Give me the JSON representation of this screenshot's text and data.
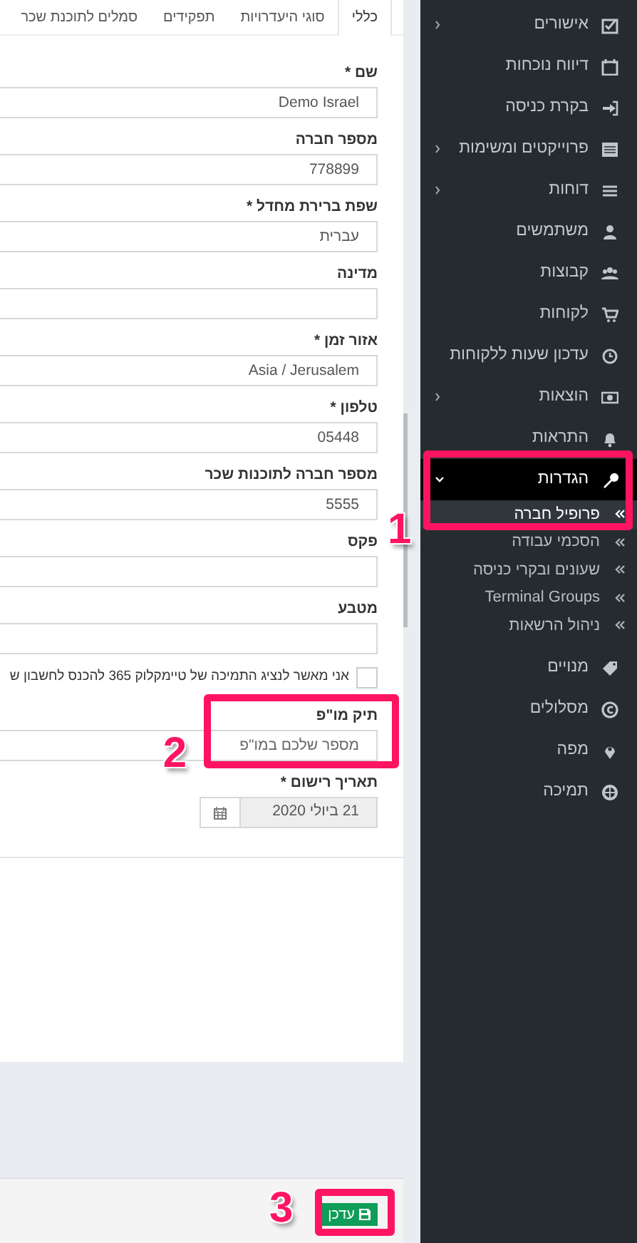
{
  "tabs": [
    {
      "label": "כללי",
      "selected": true
    },
    {
      "label": "סוגי היעדרויות",
      "selected": false
    },
    {
      "label": "תפקידים",
      "selected": false
    },
    {
      "label": "סמלים לתוכנת שכר",
      "selected": false
    }
  ],
  "form": {
    "fields": [
      {
        "kind": "text",
        "label": "שם *",
        "value": "Demo Israel"
      },
      {
        "kind": "text",
        "label": "מספר חברה",
        "value": "778899"
      },
      {
        "kind": "text",
        "label": "שפת ברירת מחדל *",
        "value": "עברית"
      },
      {
        "kind": "text",
        "label": "מדינה"
      },
      {
        "kind": "text",
        "label": "אזור זמן *",
        "value": "Asia / Jerusalem"
      },
      {
        "kind": "text",
        "label": "טלפון *",
        "value": "05448"
      },
      {
        "kind": "text",
        "label": "מספר חברה לתוכנות שכר",
        "value": "5555"
      },
      {
        "kind": "text",
        "label": "פקס"
      },
      {
        "kind": "text",
        "label": "מטבע"
      },
      {
        "kind": "checkbox",
        "label": "אני מאשר לנציג התמיכה של טיימקלוק 365 להכנס לחשבון ש",
        "checked": false
      },
      {
        "kind": "text",
        "label": "תיק מו\"פ",
        "placeholder": "מספר שלכם במו\"פ"
      },
      {
        "kind": "date",
        "label": "תאריך רישום *",
        "value": "21 ביולי 2020",
        "disabled": true
      }
    ],
    "submit": "עדכן"
  },
  "sidebar": {
    "items": [
      {
        "kind": "group",
        "label": "אישורים",
        "expanded": false
      },
      {
        "kind": "link",
        "label": "דיווח נוכחות"
      },
      {
        "kind": "link",
        "label": "בקרת כניסה"
      },
      {
        "kind": "group",
        "label": "פרוייקטים ומשימות",
        "expanded": false
      },
      {
        "kind": "group",
        "label": "דוחות",
        "expanded": false
      },
      {
        "kind": "link",
        "label": "משתמשים"
      },
      {
        "kind": "link",
        "label": "קבוצות"
      },
      {
        "kind": "link",
        "label": "לקוחות"
      },
      {
        "kind": "link",
        "label": "עדכון שעות ללקוחות"
      },
      {
        "kind": "group",
        "label": "הוצאות",
        "expanded": false
      },
      {
        "kind": "link",
        "label": "התראות"
      },
      {
        "kind": "group",
        "label": "הגדרות",
        "expanded": true,
        "children": [
          {
            "label": "פרופיל חברה",
            "selected": true
          },
          {
            "label": "הסכמי עבודה",
            "selected": false
          },
          {
            "label": "שעונים ובקרי כניסה",
            "selected": false
          },
          {
            "label": "Terminal Groups",
            "selected": false
          },
          {
            "label": "ניהול הרשאות",
            "selected": false
          }
        ]
      },
      {
        "kind": "link",
        "label": "מנויים"
      },
      {
        "kind": "link",
        "label": "מסלולים"
      },
      {
        "kind": "link",
        "label": "מפה"
      },
      {
        "kind": "link",
        "label": "תמיכה"
      }
    ]
  },
  "annotations": [
    {
      "label": "1"
    },
    {
      "label": "2"
    },
    {
      "label": "3"
    }
  ]
}
